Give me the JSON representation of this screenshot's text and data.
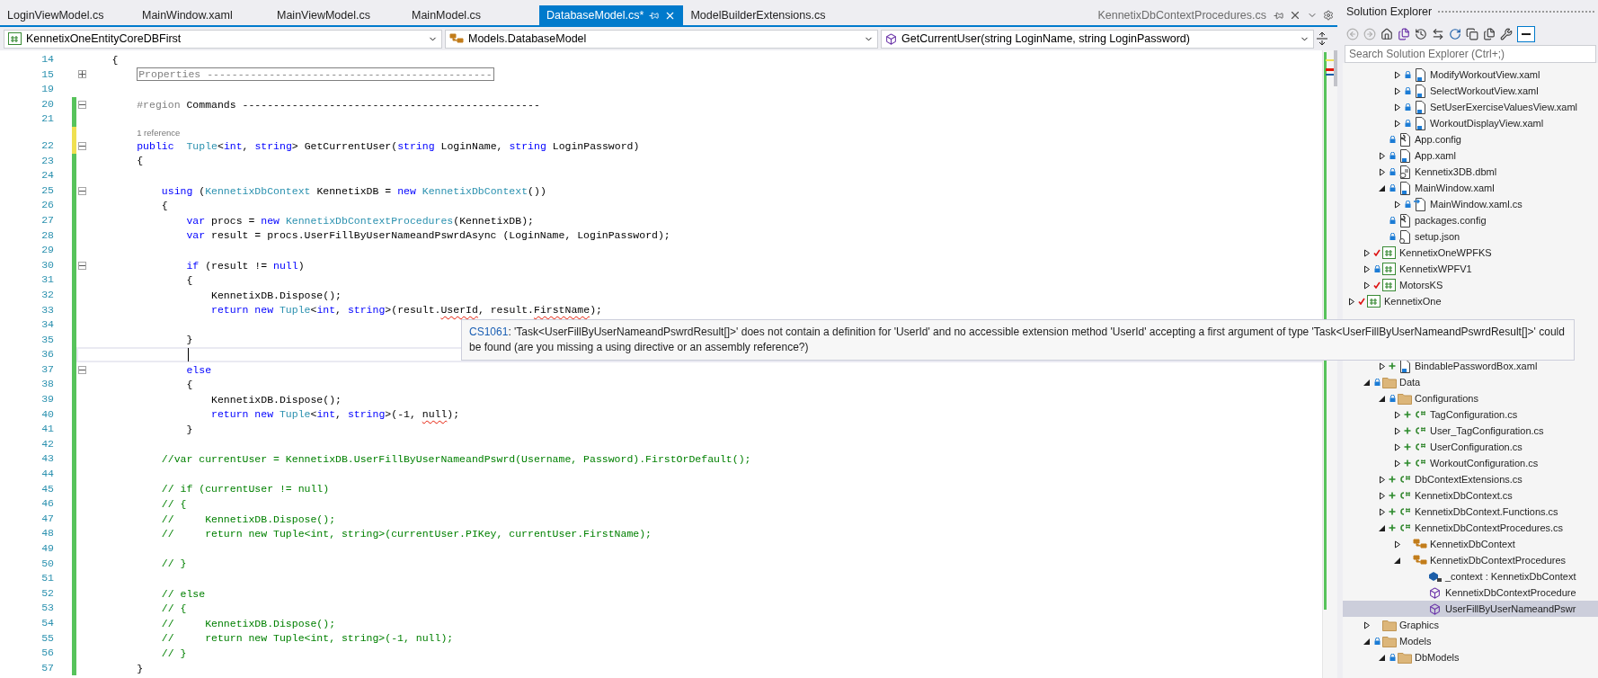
{
  "tabs": [
    {
      "label": "LoginViewModel.cs",
      "selected": false
    },
    {
      "label": "MainWindow.xaml",
      "selected": false
    },
    {
      "label": "MainViewModel.cs",
      "selected": false
    },
    {
      "label": "MainModel.cs",
      "selected": false
    },
    {
      "label": "DatabaseModel.cs*",
      "selected": true
    },
    {
      "label": "ModelBuilderExtensions.cs",
      "selected": false
    }
  ],
  "preview_tab": {
    "label": "KennetixDbContextProcedures.cs"
  },
  "navigation_bar": {
    "project": "KennetixOneEntityCoreDBFirst",
    "type": "Models.DatabaseModel",
    "member": "GetCurrentUser(string LoginName, string LoginPassword)"
  },
  "editor": {
    "lines": [
      {
        "number": "14",
        "current": false,
        "tokens": [
          {
            "kind": "plain",
            "text": "    {"
          }
        ]
      },
      {
        "number": "15",
        "collapsed": true,
        "current": false,
        "tokens": [
          {
            "kind": "collapsed",
            "text": "        Properties ----------------------------------------------"
          }
        ]
      },
      {
        "number": "19",
        "current": false
      },
      {
        "number": "20",
        "saved": true,
        "collapsed": false,
        "current": false,
        "tokens": [
          {
            "kind": "preproc",
            "text": "        #region"
          },
          {
            "kind": "plain",
            "text": " Commands ------------------------------------------------"
          }
        ]
      },
      {
        "number": "21",
        "saved": true,
        "current": false
      },
      {
        "number": "22",
        "saved": false,
        "collapsed": false,
        "current": false,
        "codelens": "1 reference",
        "tokens": [
          {
            "kind": "keyword",
            "text": "        public"
          },
          {
            "kind": "type",
            "text": "  Tuple"
          },
          {
            "kind": "plain",
            "text": "<"
          },
          {
            "kind": "keyword",
            "text": "int"
          },
          {
            "kind": "plain",
            "text": ", "
          },
          {
            "kind": "keyword",
            "text": "string"
          },
          {
            "kind": "plain",
            "text": "> GetCurrentUser("
          },
          {
            "kind": "keyword",
            "text": "string"
          },
          {
            "kind": "plain",
            "text": " LoginName, "
          },
          {
            "kind": "keyword",
            "text": "string"
          },
          {
            "kind": "plain",
            "text": " LoginPassword)"
          }
        ]
      },
      {
        "number": "23",
        "saved": true,
        "current": false,
        "tokens": [
          {
            "kind": "plain",
            "text": "        {"
          }
        ]
      },
      {
        "number": "24",
        "saved": true,
        "current": false
      },
      {
        "number": "25",
        "saved": true,
        "collapsed": false,
        "current": false,
        "tokens": [
          {
            "kind": "keyword",
            "text": "            using"
          },
          {
            "kind": "plain",
            "text": " ("
          },
          {
            "kind": "type",
            "text": "KennetixDbContext"
          },
          {
            "kind": "plain",
            "text": " KennetixDB = "
          },
          {
            "kind": "keyword",
            "text": "new"
          },
          {
            "kind": "type",
            "text": " KennetixDbContext"
          },
          {
            "kind": "plain",
            "text": "())"
          }
        ]
      },
      {
        "number": "26",
        "saved": true,
        "current": false,
        "tokens": [
          {
            "kind": "plain",
            "text": "            {"
          }
        ]
      },
      {
        "number": "27",
        "saved": true,
        "current": false,
        "tokens": [
          {
            "kind": "keyword",
            "text": "                var"
          },
          {
            "kind": "plain",
            "text": " procs = "
          },
          {
            "kind": "keyword",
            "text": "new"
          },
          {
            "kind": "type",
            "text": " KennetixDbContextProcedures"
          },
          {
            "kind": "plain",
            "text": "(KennetixDB);"
          }
        ]
      },
      {
        "number": "28",
        "saved": true,
        "current": false,
        "tokens": [
          {
            "kind": "keyword",
            "text": "                var"
          },
          {
            "kind": "plain",
            "text": " result = procs.UserFillByUserNameandPswrdAsync (LoginName, LoginPassword);"
          }
        ]
      },
      {
        "number": "29",
        "saved": true,
        "current": false
      },
      {
        "number": "30",
        "saved": true,
        "collapsed": false,
        "current": false,
        "tokens": [
          {
            "kind": "keyword",
            "text": "                if"
          },
          {
            "kind": "plain",
            "text": " (result != "
          },
          {
            "kind": "keyword",
            "text": "null"
          },
          {
            "kind": "plain",
            "text": ")"
          }
        ]
      },
      {
        "number": "31",
        "saved": true,
        "current": false,
        "tokens": [
          {
            "kind": "plain",
            "text": "                {"
          }
        ]
      },
      {
        "number": "32",
        "saved": true,
        "current": false,
        "tokens": [
          {
            "kind": "plain",
            "text": "                    KennetixDB.Dispose();"
          }
        ]
      },
      {
        "number": "33",
        "saved": true,
        "current": false,
        "tokens": [
          {
            "kind": "keyword",
            "text": "                    return new"
          },
          {
            "kind": "type",
            "text": " Tuple"
          },
          {
            "kind": "plain",
            "text": "<"
          },
          {
            "kind": "keyword",
            "text": "int"
          },
          {
            "kind": "plain",
            "text": ", "
          },
          {
            "kind": "keyword",
            "text": "string"
          },
          {
            "kind": "plain",
            "text": ">(result."
          },
          {
            "kind": "error",
            "text": "UserId"
          },
          {
            "kind": "plain",
            "text": ", result."
          },
          {
            "kind": "error",
            "text": "FirstName"
          },
          {
            "kind": "plain",
            "text": ");"
          }
        ]
      },
      {
        "number": "34",
        "saved": true,
        "current": false
      },
      {
        "number": "35",
        "saved": true,
        "current": false,
        "tokens": [
          {
            "kind": "plain",
            "text": "                }"
          }
        ]
      },
      {
        "number": "36",
        "saved": true,
        "current": true
      },
      {
        "number": "37",
        "saved": true,
        "collapsed": false,
        "current": false,
        "tokens": [
          {
            "kind": "keyword",
            "text": "                else"
          }
        ]
      },
      {
        "number": "38",
        "saved": true,
        "current": false,
        "tokens": [
          {
            "kind": "plain",
            "text": "                {"
          }
        ]
      },
      {
        "number": "39",
        "saved": true,
        "current": false,
        "tokens": [
          {
            "kind": "plain",
            "text": "                    KennetixDB.Dispose();"
          }
        ]
      },
      {
        "number": "40",
        "saved": true,
        "current": false,
        "tokens": [
          {
            "kind": "keyword",
            "text": "                    return new"
          },
          {
            "kind": "type",
            "text": " Tuple"
          },
          {
            "kind": "plain",
            "text": "<"
          },
          {
            "kind": "keyword",
            "text": "int"
          },
          {
            "kind": "plain",
            "text": ", "
          },
          {
            "kind": "keyword",
            "text": "string"
          },
          {
            "kind": "plain",
            "text": ">(-1, "
          },
          {
            "kind": "error",
            "text": "null"
          },
          {
            "kind": "plain",
            "text": ");"
          }
        ]
      },
      {
        "number": "41",
        "saved": true,
        "current": false,
        "tokens": [
          {
            "kind": "plain",
            "text": "                }"
          }
        ]
      },
      {
        "number": "42",
        "saved": true,
        "current": false
      },
      {
        "number": "43",
        "saved": true,
        "current": false,
        "tokens": [
          {
            "kind": "comment",
            "text": "            //var currentUser = KennetixDB.UserFillByUserNameandPswrd(Username, Password).FirstOrDefault();"
          }
        ]
      },
      {
        "number": "44",
        "saved": true,
        "current": false
      },
      {
        "number": "45",
        "saved": true,
        "current": false,
        "tokens": [
          {
            "kind": "comment",
            "text": "            // if (currentUser != null)"
          }
        ]
      },
      {
        "number": "46",
        "saved": true,
        "current": false,
        "tokens": [
          {
            "kind": "comment",
            "text": "            // {"
          }
        ]
      },
      {
        "number": "47",
        "saved": true,
        "current": false,
        "tokens": [
          {
            "kind": "comment",
            "text": "            //     KennetixDB.Dispose();"
          }
        ]
      },
      {
        "number": "48",
        "saved": true,
        "current": false,
        "tokens": [
          {
            "kind": "comment",
            "text": "            //     return new Tuple<int, string>(currentUser.PIKey, currentUser.FirstName);"
          }
        ]
      },
      {
        "number": "49",
        "saved": true,
        "current": false
      },
      {
        "number": "50",
        "saved": true,
        "current": false,
        "tokens": [
          {
            "kind": "comment",
            "text": "            // }"
          }
        ]
      },
      {
        "number": "51",
        "saved": true,
        "current": false
      },
      {
        "number": "52",
        "saved": true,
        "current": false,
        "tokens": [
          {
            "kind": "comment",
            "text": "            // else"
          }
        ]
      },
      {
        "number": "53",
        "saved": true,
        "current": false,
        "tokens": [
          {
            "kind": "comment",
            "text": "            // {"
          }
        ]
      },
      {
        "number": "54",
        "saved": true,
        "current": false,
        "tokens": [
          {
            "kind": "comment",
            "text": "            //     KennetixDB.Dispose();"
          }
        ]
      },
      {
        "number": "55",
        "saved": true,
        "current": false,
        "tokens": [
          {
            "kind": "comment",
            "text": "            //     return new Tuple<int, string>(-1, null);"
          }
        ]
      },
      {
        "number": "56",
        "saved": true,
        "current": false,
        "tokens": [
          {
            "kind": "comment",
            "text": "            // }"
          }
        ]
      },
      {
        "number": "57",
        "saved": true,
        "current": false,
        "tokens": [
          {
            "kind": "plain",
            "text": "        }"
          }
        ]
      }
    ]
  },
  "error_tooltip": {
    "code": "CS1061",
    "message": ": 'Task<UserFillByUserNameandPswrdResult[]>' does not contain a definition for 'UserId' and no accessible extension method 'UserId' accepting a first argument of type 'Task<UserFillByUserNameandPswrdResult[]>' could be found (are you missing a using directive or an assembly reference?)"
  },
  "solution_explorer": {
    "title": "Solution Explorer",
    "search": {
      "placeholder": "Search Solution Explorer (Ctrl+;)"
    },
    "tree": [
      {
        "children": [
          {
            "children": [
              {
                "children": [
                  {
                    "label": "ModifyWorkoutView.xaml",
                    "kind": "xaml",
                    "locked": true,
                    "expanded": false,
                    "selected": false
                  },
                  {
                    "label": "SelectWorkoutView.xaml",
                    "kind": "xaml",
                    "locked": true,
                    "expanded": false,
                    "selected": false
                  },
                  {
                    "label": "SetUserExerciseValuesView.xaml",
                    "kind": "xaml",
                    "locked": true,
                    "expanded": false,
                    "selected": false
                  },
                  {
                    "label": "WorkoutDisplayView.xaml",
                    "kind": "xaml",
                    "locked": true,
                    "expanded": false,
                    "selected": false
                  }
                ]
              },
              {
                "label": "App.config",
                "kind": "config",
                "locked": true,
                "selected": false
              },
              {
                "label": "App.xaml",
                "kind": "xaml",
                "locked": true,
                "expanded": false,
                "selected": false
              },
              {
                "label": "Kennetix3DB.dbml",
                "kind": "dbml",
                "locked": true,
                "expanded": false,
                "selected": false
              },
              {
                "label": "MainWindow.xaml",
                "kind": "xaml",
                "locked": true,
                "expanded": true,
                "selected": false,
                "children": [
                  {
                    "label": "MainWindow.xaml.cs",
                    "kind": "codebehind",
                    "locked": true,
                    "expanded": false,
                    "selected": false
                  }
                ]
              },
              {
                "label": "packages.config",
                "kind": "config",
                "locked": true,
                "selected": false
              },
              {
                "label": "setup.json",
                "kind": "json",
                "locked": true,
                "selected": false
              }
            ]
          },
          {
            "label": "KennetixOneWPFKS",
            "kind": "project",
            "checked_out": true,
            "expanded": false,
            "selected": false
          },
          {
            "label": "KennetixWPFV1",
            "kind": "project",
            "locked": true,
            "expanded": false,
            "selected": false
          },
          {
            "label": "MotorsKS",
            "kind": "project",
            "checked_out": true,
            "expanded": false,
            "selected": false
          }
        ]
      },
      {
        "label": "KennetixOne",
        "kind": "project",
        "checked_out": true,
        "expanded": false,
        "selected": false
      }
    ],
    "tree_continued": [
      {
        "children": [
          {
            "children": [
              {
                "label": "BindablePasswordBox.xaml",
                "kind": "xaml",
                "added": true,
                "expanded": false,
                "selected": false
              }
            ]
          },
          {
            "label": "Data",
            "kind": "folder",
            "locked": true,
            "expanded": true,
            "selected": false,
            "children": [
              {
                "label": "Configurations",
                "kind": "folder",
                "locked": true,
                "expanded": true,
                "selected": false,
                "children": [
                  {
                    "label": "TagConfiguration.cs",
                    "kind": "cs",
                    "added": true,
                    "expanded": false,
                    "selected": false
                  },
                  {
                    "label": "User_TagConfiguration.cs",
                    "kind": "cs",
                    "added": true,
                    "expanded": false,
                    "selected": false
                  },
                  {
                    "label": "UserConfiguration.cs",
                    "kind": "cs",
                    "added": true,
                    "expanded": false,
                    "selected": false
                  },
                  {
                    "label": "WorkoutConfiguration.cs",
                    "kind": "cs",
                    "added": true,
                    "expanded": false,
                    "selected": false
                  }
                ]
              },
              {
                "label": "DbContextExtensions.cs",
                "kind": "cs",
                "added": true,
                "expanded": false,
                "selected": false
              },
              {
                "label": "KennetixDbContext.cs",
                "kind": "cs",
                "added": true,
                "expanded": false,
                "selected": false
              },
              {
                "label": "KennetixDbContext.Functions.cs",
                "kind": "cs",
                "added": true,
                "expanded": false,
                "selected": false
              },
              {
                "label": "KennetixDbContextProcedures.cs",
                "kind": "cs",
                "added": true,
                "expanded": true,
                "selected": false,
                "children": [
                  {
                    "label": "KennetixDbContext",
                    "kind": "class",
                    "expanded": false,
                    "selected": false
                  },
                  {
                    "label": "KennetixDbContextProcedures",
                    "kind": "class",
                    "expanded": true,
                    "selected": false,
                    "children": [
                      {
                        "label": "_context : KennetixDbContext",
                        "kind": "field",
                        "selected": false
                      },
                      {
                        "label": "KennetixDbContextProcedure",
                        "kind": "method",
                        "selected": false
                      },
                      {
                        "label": "UserFillByUserNameandPswr",
                        "kind": "method",
                        "selected": true
                      }
                    ]
                  }
                ]
              }
            ]
          },
          {
            "label": "Graphics",
            "kind": "folder",
            "expanded": false,
            "selected": false
          },
          {
            "label": "Models",
            "kind": "folder",
            "locked": true,
            "expanded": true,
            "selected": false,
            "children": [
              {
                "label": "DbModels",
                "kind": "folder",
                "locked": true,
                "expanded": true,
                "selected": false
              }
            ]
          }
        ]
      }
    ]
  }
}
